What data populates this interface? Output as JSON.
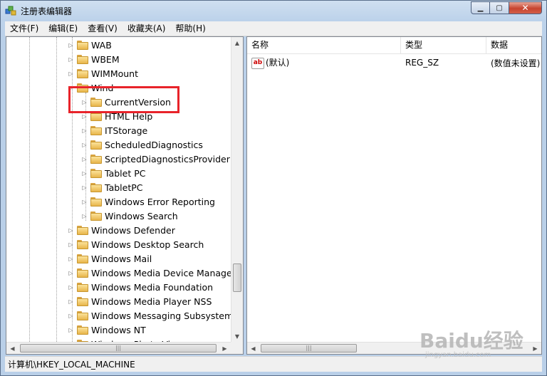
{
  "window": {
    "title": "注册表编辑器"
  },
  "menu": [
    {
      "label": "文件(F)"
    },
    {
      "label": "编辑(E)"
    },
    {
      "label": "查看(V)"
    },
    {
      "label": "收藏夹(A)"
    },
    {
      "label": "帮助(H)"
    }
  ],
  "tree": [
    {
      "label": "WAB",
      "level": 0
    },
    {
      "label": "WBEM",
      "level": 0
    },
    {
      "label": "WIMMount",
      "level": 0
    },
    {
      "label": "Wind",
      "level": 0
    },
    {
      "label": "CurrentVersion",
      "level": 1
    },
    {
      "label": "HTML Help",
      "level": 1
    },
    {
      "label": "ITStorage",
      "level": 1
    },
    {
      "label": "ScheduledDiagnostics",
      "level": 1
    },
    {
      "label": "ScriptedDiagnosticsProvider",
      "level": 1
    },
    {
      "label": "Tablet PC",
      "level": 1
    },
    {
      "label": "TabletPC",
      "level": 1
    },
    {
      "label": "Windows Error Reporting",
      "level": 1
    },
    {
      "label": "Windows Search",
      "level": 1
    },
    {
      "label": "Windows Defender",
      "level": 0
    },
    {
      "label": "Windows Desktop Search",
      "level": 0
    },
    {
      "label": "Windows Mail",
      "level": 0
    },
    {
      "label": "Windows Media Device Manager",
      "level": 0
    },
    {
      "label": "Windows Media Foundation",
      "level": 0
    },
    {
      "label": "Windows Media Player NSS",
      "level": 0
    },
    {
      "label": "Windows Messaging Subsystem",
      "level": 0
    },
    {
      "label": "Windows NT",
      "level": 0
    },
    {
      "label": "Windows Photo Vi",
      "level": 0
    }
  ],
  "list": {
    "headers": {
      "name": "名称",
      "type": "类型",
      "data": "数据"
    },
    "rows": [
      {
        "name": "(默认)",
        "type": "REG_SZ",
        "data": "(数值未设置)"
      }
    ]
  },
  "status": {
    "path": "计算机\\HKEY_LOCAL_MACHINE"
  },
  "watermark": {
    "main": "Baidu经验",
    "sub": "jingyan.baidu.com"
  },
  "icons": {
    "app": "registry-icon",
    "folder": "folder-icon",
    "string_value": "string-value-icon"
  },
  "colors": {
    "highlight": "#e8232a",
    "folder": "#e8b64b"
  }
}
